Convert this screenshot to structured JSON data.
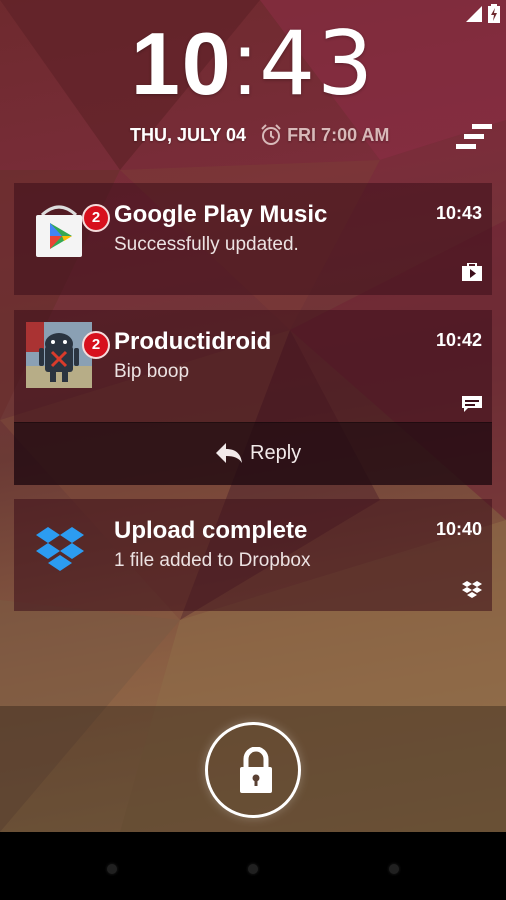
{
  "clock": {
    "hours": "10",
    "separator": ":",
    "minutes": "43"
  },
  "date": {
    "label": "THU, JULY 04",
    "alarm": "FRI 7:00 AM"
  },
  "notifications": [
    {
      "app": "Google Play Music",
      "title": "Google Play Music",
      "text": "Successfully updated.",
      "time": "10:43",
      "badge": "2",
      "icon": "play-store-icon",
      "small_icon": "play-music-icon"
    },
    {
      "app": "Productidroid",
      "title": "Productidroid",
      "text": "Bip boop",
      "time": "10:42",
      "badge": "2",
      "icon": "android-avatar-icon",
      "small_icon": "message-icon",
      "action": "Reply"
    },
    {
      "app": "Dropbox",
      "title": "Upload complete",
      "text": "1 file added to Dropbox",
      "time": "10:40",
      "icon": "dropbox-icon",
      "small_icon": "dropbox-small-icon"
    }
  ],
  "colors": {
    "badge": "#d7101d",
    "notification_bg": "#3c0e1a"
  }
}
